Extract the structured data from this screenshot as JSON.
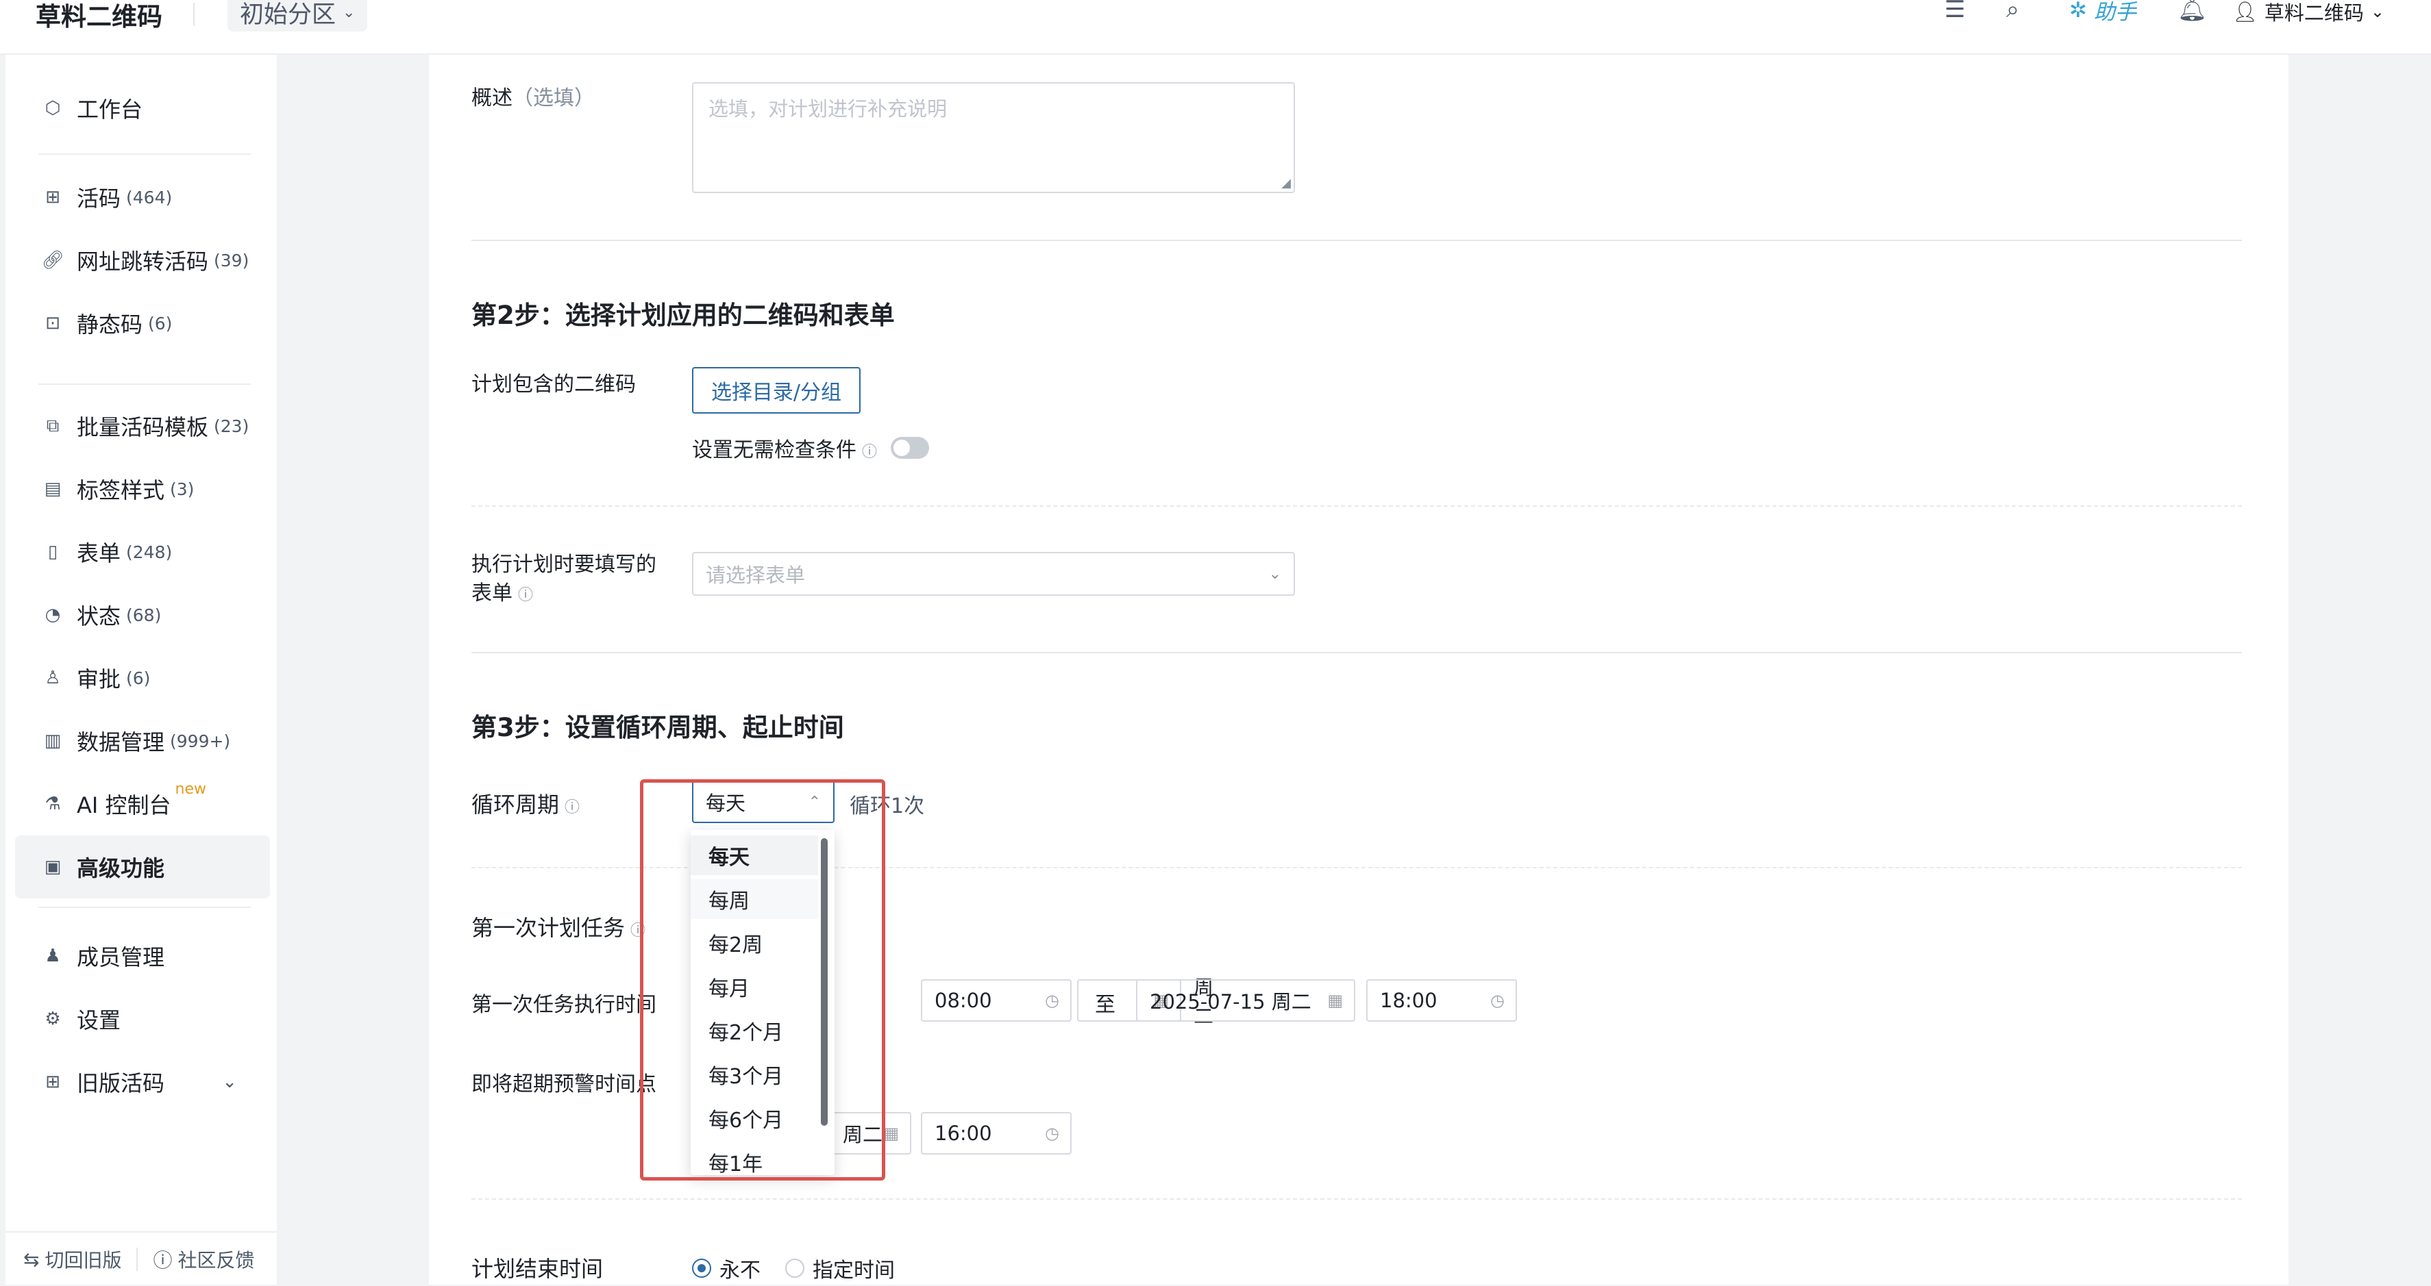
{
  "header": {
    "logo": "草料二维码",
    "space": "初始分区",
    "assistant": "助手",
    "user": "草料二维码"
  },
  "sidebar": {
    "items": [
      {
        "label": "工作台",
        "count": "",
        "icon": "cube-icon"
      },
      {
        "label": "活码",
        "count": "(464)",
        "icon": "qrcode-icon"
      },
      {
        "label": "网址跳转活码",
        "count": "(39)",
        "icon": "link-icon"
      },
      {
        "label": "静态码",
        "count": "(6)",
        "icon": "static-qr-icon"
      },
      {
        "label": "批量活码模板",
        "count": "(23)",
        "icon": "batch-icon"
      },
      {
        "label": "标签样式",
        "count": "(3)",
        "icon": "label-icon"
      },
      {
        "label": "表单",
        "count": "(248)",
        "icon": "form-icon"
      },
      {
        "label": "状态",
        "count": "(68)",
        "icon": "status-icon"
      },
      {
        "label": "审批",
        "count": "(6)",
        "icon": "approval-icon"
      },
      {
        "label": "数据管理",
        "count": "(999+)",
        "icon": "chart-icon"
      },
      {
        "label": "AI 控制台",
        "count": "",
        "badge": "new",
        "icon": "ai-icon"
      },
      {
        "label": "高级功能",
        "count": "",
        "icon": "briefcase-icon"
      },
      {
        "label": "成员管理",
        "count": "",
        "icon": "member-icon"
      },
      {
        "label": "设置",
        "count": "",
        "icon": "gear-icon"
      },
      {
        "label": "旧版活码",
        "count": "",
        "icon": "grid-icon"
      }
    ],
    "footer": {
      "switch_old": "切回旧版",
      "feedback": "社区反馈"
    }
  },
  "form": {
    "desc_label": "概述",
    "desc_optional": "（选填）",
    "desc_placeholder": "选填，对计划进行补充说明",
    "step2_title": "第2步：选择计划应用的二维码和表单",
    "qr_label": "计划包含的二维码",
    "select_dir_button": "选择目录/分组",
    "no_check_label": "设置无需检查条件",
    "form_label_line1": "执行计划时要填写的",
    "form_label_line2": "表单",
    "form_select_placeholder": "请选择表单",
    "step3_title": "第3步：设置循环周期、起止时间",
    "cycle_label": "循环周期",
    "cycle_value": "每天",
    "cycle_hint": "循环1次",
    "first_task_label": "第一次计划任务",
    "first_exec_label": "第一次任务执行时间",
    "start_date_partial": "周二",
    "start_time": "08:00",
    "to_label": "至",
    "end_date": "2025-07-15 周二",
    "end_time": "18:00",
    "warning_label": "即将超期预警时间点",
    "warning_date_partial": "周二",
    "warning_time": "16:00",
    "end_plan_label": "计划结束时间",
    "end_option_never": "永不",
    "end_option_specific": "指定时间"
  },
  "dropdown": {
    "options": [
      "每天",
      "每周",
      "每2周",
      "每月",
      "每2个月",
      "每3个月",
      "每6个月",
      "每1年"
    ],
    "selected": "每天"
  },
  "colors": {
    "primary": "#2d6aa4",
    "highlight": "#d9534f",
    "new_badge": "#e39b1e"
  }
}
